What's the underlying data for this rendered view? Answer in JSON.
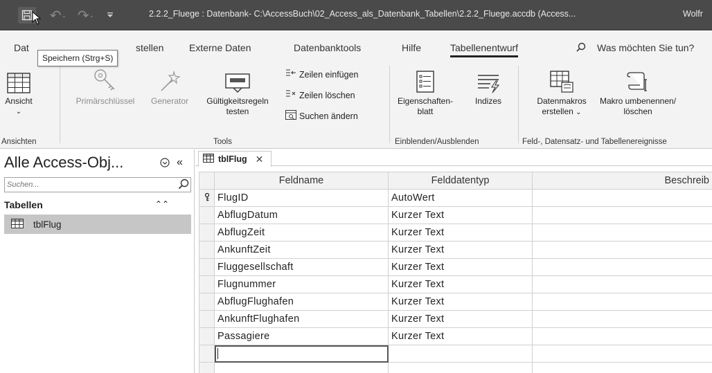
{
  "titlebar": {
    "title": "2.2.2_Fluege : Datenbank- C:\\AccessBuch\\02_Access_als_Datenbank_Tabellen\\2.2.2_Fluege.accdb (Access...",
    "user": "Wolfr",
    "save_icon": "save-icon",
    "undo_icon": "undo-icon",
    "redo_icon": "redo-icon",
    "bg_color": "#4a4a4a"
  },
  "tooltip": {
    "text": "Speichern (Strg+S)"
  },
  "ribbon_tabs": [
    {
      "label": "Dat"
    },
    {
      "label": "stellen"
    },
    {
      "label": "Externe Daten"
    },
    {
      "label": "Datenbanktools"
    },
    {
      "label": "Hilfe"
    },
    {
      "label": "Tabellenentwurf",
      "active": true
    }
  ],
  "tell_me": {
    "placeholder": "Was möchten Sie tun?",
    "icon": "search-icon"
  },
  "ribbon": {
    "ansicht": {
      "label": "Ansicht",
      "icon": "view-table-icon"
    },
    "primaerschluessel": {
      "label": "Primärschlüssel",
      "icon": "key-icon"
    },
    "generator": {
      "label": "Generator",
      "icon": "wand-icon"
    },
    "gueltigkeitsregeln_line1": "Gültigkeitsregeln",
    "gueltigkeitsregeln_line2": "testen",
    "zeilen_einfuegen": "Zeilen einfügen",
    "zeilen_loeschen": "Zeilen löschen",
    "suchen_aendern": "Suchen ändern",
    "eigenschaftenblatt_line1": "Eigenschaften-",
    "eigenschaftenblatt_line2": "blatt",
    "indizes": "Indizes",
    "datenmakros_line1": "Datenmakros",
    "datenmakros_line2": "erstellen",
    "makro_line1": "Makro umbenennen/",
    "makro_line2": "löschen",
    "groups": {
      "ansichten": "Ansichten",
      "tools": "Tools",
      "einblenden": "Einblenden/Ausblenden",
      "ereignisse": "Feld-, Datensatz- und Tabellenereignisse"
    }
  },
  "nav": {
    "title": "Alle Access-Obj...",
    "search_placeholder": "Suchen...",
    "section": "Tabellen",
    "items": [
      {
        "label": "tblFlug",
        "icon": "table-icon"
      }
    ]
  },
  "document_tab": {
    "label": "tblFlug",
    "icon": "table-icon"
  },
  "grid": {
    "headers": {
      "name": "Feldname",
      "type": "Felddatentyp",
      "desc": "Beschreib"
    },
    "rows": [
      {
        "name": "FlugID",
        "type": "AutoWert",
        "primary_key": true
      },
      {
        "name": "AbflugDatum",
        "type": "Kurzer Text"
      },
      {
        "name": "AbflugZeit",
        "type": "Kurzer Text"
      },
      {
        "name": "AnkunftZeit",
        "type": "Kurzer Text"
      },
      {
        "name": "Fluggesellschaft",
        "type": "Kurzer Text"
      },
      {
        "name": "Flugnummer",
        "type": "Kurzer Text"
      },
      {
        "name": "AbflugFlughafen",
        "type": "Kurzer Text"
      },
      {
        "name": "AnkunftFlughafen",
        "type": "Kurzer Text"
      },
      {
        "name": "Passagiere",
        "type": "Kurzer Text"
      }
    ]
  }
}
